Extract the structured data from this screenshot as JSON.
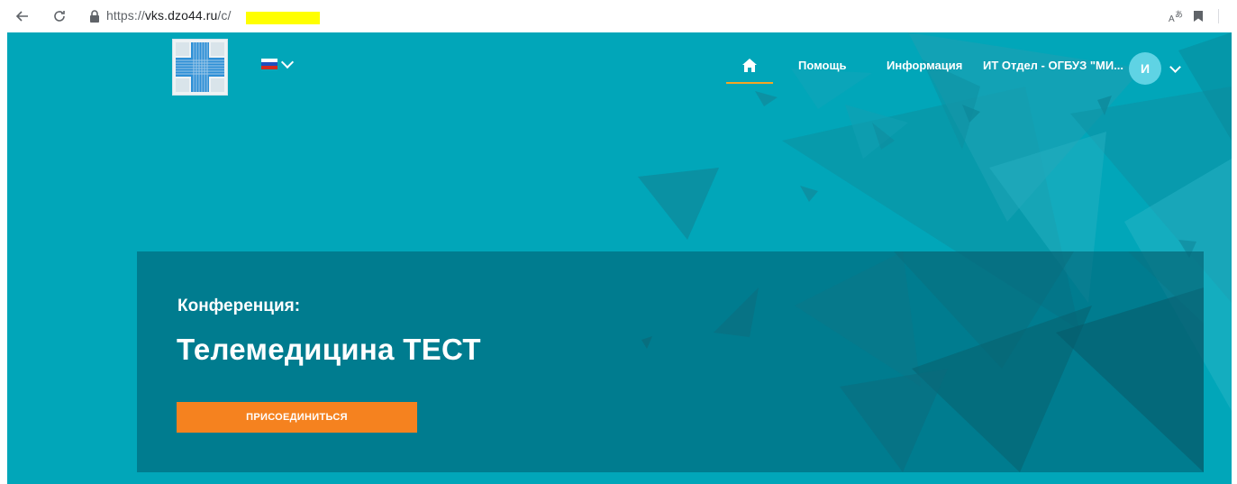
{
  "browser": {
    "url_prefix": "https://",
    "url_host": "vks.dzo44.ru",
    "url_path": "/c/"
  },
  "header": {
    "nav_home_icon": "home-icon",
    "nav_help": "Помощь",
    "nav_info": "Информация",
    "nav_org": "ИТ Отдел - ОГБУЗ \"МИ...",
    "avatar_initial": "И",
    "language_flag": "russian-flag-icon"
  },
  "conference": {
    "label": "Конференция:",
    "title": "Телемедицина ТЕСТ",
    "join_button": "ПРИСОЕДИНИТЬСЯ"
  },
  "colors": {
    "page_bg": "#01a6b9",
    "card_bg": "rgba(0, 90, 110, 0.55)",
    "join_button": "#f5821f",
    "active_nav_underline": "#f5a623",
    "avatar_bg": "#5fd3e4"
  }
}
